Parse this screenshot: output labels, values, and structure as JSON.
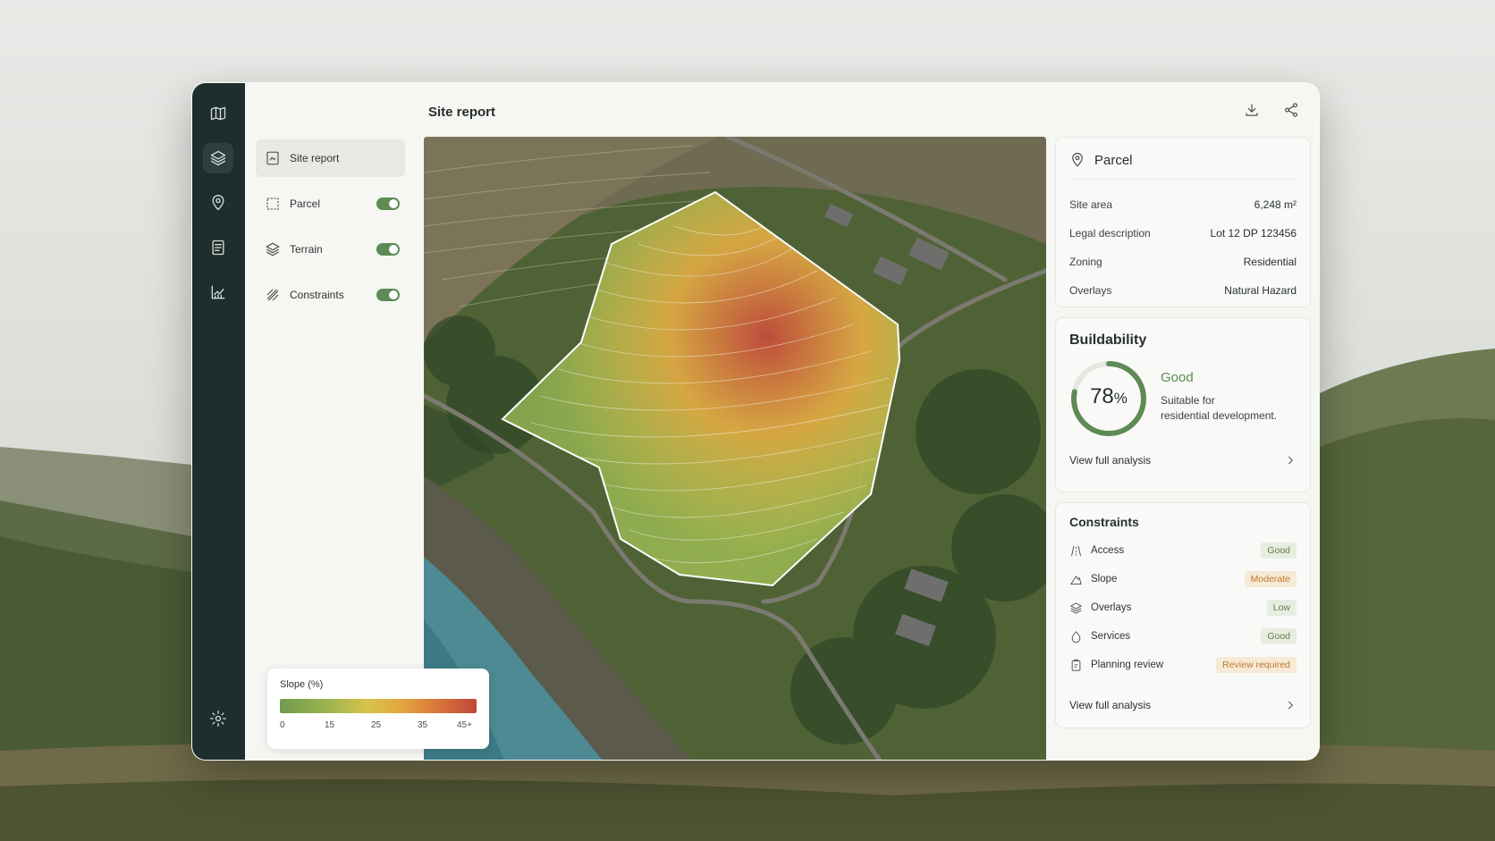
{
  "colors": {
    "accent": "#5d8a55",
    "rail": "#1e2e2d",
    "moderate": "#c27a2a",
    "good": "#5f7f4a"
  },
  "rail": {
    "items": [
      {
        "icon": "map-icon"
      },
      {
        "icon": "layers-icon"
      },
      {
        "icon": "location-pin-icon"
      },
      {
        "icon": "document-icon"
      },
      {
        "icon": "chart-icon"
      }
    ],
    "settings_icon": "gear-icon"
  },
  "sidebar": {
    "items": [
      {
        "label": "Site report",
        "icon": "report-icon",
        "active": true
      },
      {
        "label": "Parcel",
        "icon": "parcel-icon",
        "toggle": true
      },
      {
        "label": "Terrain",
        "icon": "layers-icon",
        "toggle": true
      },
      {
        "label": "Constraints",
        "icon": "hatch-icon",
        "toggle": true
      }
    ]
  },
  "header": {
    "title": "Site report",
    "download_icon": "download-icon",
    "share_icon": "share-icon"
  },
  "legend": {
    "title": "Slope (%)",
    "ticks": [
      "0",
      "15",
      "25",
      "35",
      "45+"
    ]
  },
  "parcel": {
    "title": "Parcel",
    "rows": [
      {
        "label": "Site area",
        "value": "6,248 m²"
      },
      {
        "label": "Legal description",
        "value": "Lot 12 DP 123456"
      },
      {
        "label": "Zoning",
        "value": "Residential"
      },
      {
        "label": "Overlays",
        "value": "Natural Hazard"
      }
    ]
  },
  "buildability": {
    "title": "Buildability",
    "percent_number": "78",
    "percent_sign": "%",
    "score": 0.78,
    "status": "Good",
    "desc_line1": "Suitable for",
    "desc_line2": "residential development.",
    "link": "View full analysis"
  },
  "constraints": {
    "title": "Constraints",
    "rows": [
      {
        "label": "Access",
        "status": "Good"
      },
      {
        "label": "Slope",
        "status": "Moderate"
      },
      {
        "label": "Overlays",
        "status": "Low"
      },
      {
        "label": "Services",
        "status": "Good"
      },
      {
        "label": "Planning review",
        "status": "Review required"
      }
    ],
    "link": "View full analysis"
  }
}
